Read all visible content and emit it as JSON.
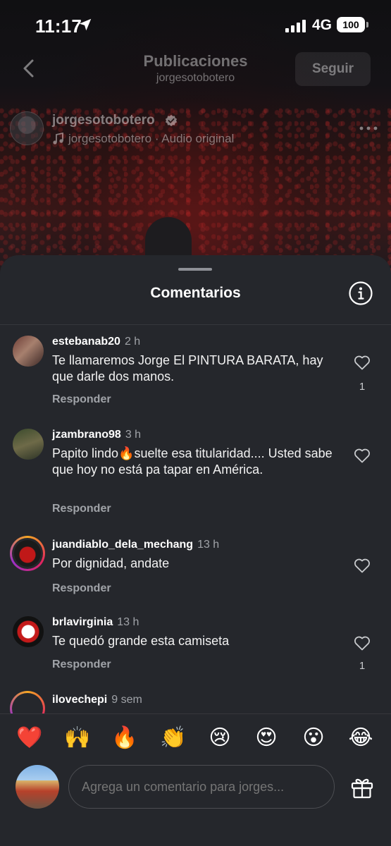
{
  "status_bar": {
    "time": "11:17",
    "network": "4G",
    "battery": "100"
  },
  "header": {
    "title": "Publicaciones",
    "subtitle": "jorgesotobotero",
    "follow_label": "Seguir"
  },
  "post": {
    "author": "jorgesotobotero",
    "audio": "jorgesotobotero · Audio original"
  },
  "sheet": {
    "title": "Comentarios",
    "reply_label": "Responder",
    "comments": [
      {
        "user": "estebanab20",
        "time": "2 h",
        "text": "Te llamaremos Jorge El PINTURA BARATA, hay que darle dos manos.",
        "likes": "1"
      },
      {
        "user": "jzambrano98",
        "time": "3 h",
        "text": "Papito lindo🔥suelte esa titularidad.... Usted sabe que hoy no está pa tapar en América.",
        "likes": ""
      },
      {
        "user": "juandiablo_dela_mechang",
        "time": "13 h",
        "text": "Por dignidad, andate",
        "likes": ""
      },
      {
        "user": "brlavirginia",
        "time": "13 h",
        "text": "Te quedó grande esta camiseta",
        "likes": "1"
      },
      {
        "user": "ilovechepi",
        "time": "9 sem",
        "text": "",
        "likes": ""
      }
    ]
  },
  "composer": {
    "emojis": [
      "❤️",
      "🙌",
      "🔥",
      "👏",
      "😢",
      "😍",
      "😮",
      "😂"
    ],
    "placeholder": "Agrega un comentario para jorges..."
  }
}
